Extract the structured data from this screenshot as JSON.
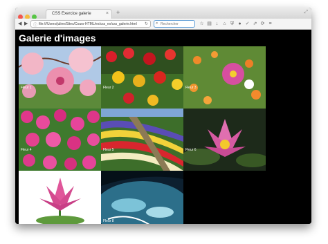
{
  "browser": {
    "tab_title": "CSS Exercice galerie",
    "tab_close": "×",
    "new_tab": "+",
    "url": "file:///Users/julien/Sites/Cours-HTML/ex/css_ex/css_galerie.html",
    "search_placeholder": "Rechercher",
    "back_glyph": "◀",
    "forward_glyph": "▶",
    "reload_glyph": "↻",
    "info_glyph": "ⓘ",
    "search_glyph": "⌕",
    "fullscreen_glyph": "⤢",
    "toolbar_icons": [
      {
        "name": "bookmark-star-icon",
        "glyph": "☆"
      },
      {
        "name": "reading-list-icon",
        "glyph": "▤"
      },
      {
        "name": "download-icon",
        "glyph": "↓"
      },
      {
        "name": "home-icon",
        "glyph": "⌂"
      },
      {
        "name": "shield-icon",
        "glyph": "⛨"
      },
      {
        "name": "extension-icon",
        "glyph": "●"
      },
      {
        "name": "pocket-icon",
        "glyph": "✓"
      },
      {
        "name": "share-icon",
        "glyph": "⇗"
      },
      {
        "name": "sync-icon",
        "glyph": "⟳"
      },
      {
        "name": "menu-icon",
        "glyph": "≡"
      }
    ],
    "accent_color": "#5b9bd5"
  },
  "page": {
    "title": "Galerie d'images",
    "background": "#000000",
    "gallery": [
      {
        "caption": "Fleur 1",
        "subject": "pink cherry blossoms"
      },
      {
        "caption": "Fleur 2",
        "subject": "red and yellow tulips"
      },
      {
        "caption": "Fleur 3",
        "subject": "pink cosmos meadow"
      },
      {
        "caption": "Fleur 4",
        "subject": "pink flower bed"
      },
      {
        "caption": "Fleur 5",
        "subject": "tulip field rows"
      },
      {
        "caption": "Fleur 6",
        "subject": "pink water lily"
      },
      {
        "caption": "Fleur 7",
        "subject": "pink lotus"
      },
      {
        "caption": "Fleur 8",
        "subject": "underwater scene"
      }
    ]
  }
}
